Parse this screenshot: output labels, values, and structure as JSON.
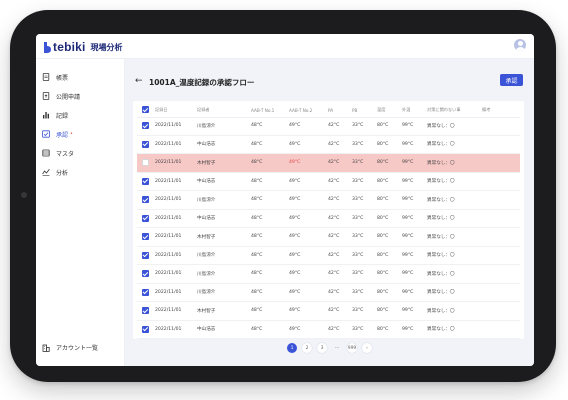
{
  "app": {
    "logo_text": "tebiki",
    "logo_sub": "現場分析"
  },
  "sidebar": {
    "items": [
      {
        "label": "帳票",
        "icon": "document-icon"
      },
      {
        "label": "公開申請",
        "icon": "upload-document-icon"
      },
      {
        "label": "記録",
        "icon": "bar-chart-icon"
      },
      {
        "label": "承認",
        "icon": "approval-icon",
        "badge": "•"
      },
      {
        "label": "マスタ",
        "icon": "list-icon"
      },
      {
        "label": "分析",
        "icon": "analytics-icon"
      }
    ],
    "account_label": "アカウント一覧"
  },
  "page": {
    "title": "1001A_温度記録の承認フロー",
    "back": "←",
    "approve_label": "承認"
  },
  "table": {
    "columns": [
      "記録日",
      "記録者",
      "AAB-T No.1",
      "AAB-T No.2",
      "PA",
      "PB",
      "温度",
      "外温",
      "対策に関わない事",
      "備考"
    ],
    "rows": [
      {
        "date": "2022/11/01",
        "name": "川島涼介",
        "v1": "48°C",
        "v2": "49°C",
        "pa": "42°C",
        "pb": "33°C",
        "temp": "80°C",
        "ext": "99°C",
        "note": "異常なし：〇",
        "checked": true
      },
      {
        "date": "2022/11/01",
        "name": "中山浩志",
        "v1": "48°C",
        "v2": "49°C",
        "pa": "42°C",
        "pb": "33°C",
        "temp": "80°C",
        "ext": "99°C",
        "note": "異常なし：〇",
        "checked": true
      },
      {
        "date": "2022/11/01",
        "name": "木村智子",
        "v1": "48°C",
        "v2": "49°C",
        "pa": "42°C",
        "pb": "33°C",
        "temp": "80°C",
        "ext": "99°C",
        "note": "異常なし：〇",
        "checked": false,
        "highlight": true
      },
      {
        "date": "2022/11/01",
        "name": "中山浩志",
        "v1": "48°C",
        "v2": "49°C",
        "pa": "42°C",
        "pb": "33°C",
        "temp": "80°C",
        "ext": "99°C",
        "note": "異常なし：〇",
        "checked": true
      },
      {
        "date": "2022/11/01",
        "name": "川島涼介",
        "v1": "48°C",
        "v2": "49°C",
        "pa": "42°C",
        "pb": "33°C",
        "temp": "80°C",
        "ext": "99°C",
        "note": "異常なし：〇",
        "checked": true
      },
      {
        "date": "2022/11/01",
        "name": "中山浩志",
        "v1": "48°C",
        "v2": "49°C",
        "pa": "42°C",
        "pb": "33°C",
        "temp": "80°C",
        "ext": "99°C",
        "note": "異常なし：〇",
        "checked": true
      },
      {
        "date": "2022/11/01",
        "name": "木村智子",
        "v1": "48°C",
        "v2": "49°C",
        "pa": "42°C",
        "pb": "33°C",
        "temp": "80°C",
        "ext": "99°C",
        "note": "異常なし：〇",
        "checked": true
      },
      {
        "date": "2022/11/01",
        "name": "川島涼介",
        "v1": "48°C",
        "v2": "49°C",
        "pa": "42°C",
        "pb": "33°C",
        "temp": "80°C",
        "ext": "99°C",
        "note": "異常なし：〇",
        "checked": true
      },
      {
        "date": "2022/11/01",
        "name": "川島涼介",
        "v1": "48°C",
        "v2": "49°C",
        "pa": "42°C",
        "pb": "33°C",
        "temp": "80°C",
        "ext": "99°C",
        "note": "異常なし：〇",
        "checked": true
      },
      {
        "date": "2022/11/01",
        "name": "川島涼介",
        "v1": "48°C",
        "v2": "49°C",
        "pa": "42°C",
        "pb": "33°C",
        "temp": "80°C",
        "ext": "99°C",
        "note": "異常なし：〇",
        "checked": true
      },
      {
        "date": "2022/11/01",
        "name": "木村智子",
        "v1": "48°C",
        "v2": "49°C",
        "pa": "42°C",
        "pb": "33°C",
        "temp": "80°C",
        "ext": "99°C",
        "note": "異常なし：〇",
        "checked": true
      },
      {
        "date": "2022/11/01",
        "name": "中山浩志",
        "v1": "48°C",
        "v2": "49°C",
        "pa": "42°C",
        "pb": "33°C",
        "temp": "80°C",
        "ext": "99°C",
        "note": "異常なし：〇",
        "checked": true
      }
    ]
  },
  "pagination": {
    "pages": [
      "1",
      "2",
      "3",
      "⋯",
      "999"
    ],
    "current": "1",
    "next": "›"
  },
  "colors": {
    "accent": "#3b53d6",
    "highlight_row": "#f6c8c6",
    "warn_text": "#e24d4d",
    "background": "#f1f3f9"
  }
}
